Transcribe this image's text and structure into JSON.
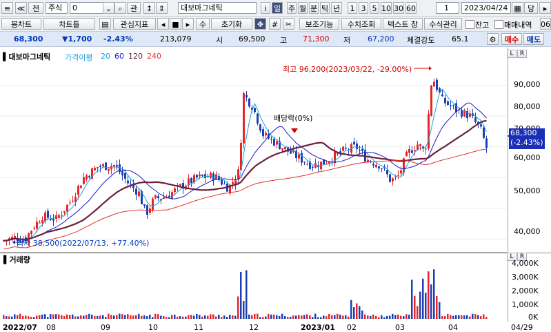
{
  "toolbar1": {
    "market": "주식",
    "code": "0",
    "search_icon": "search-icon",
    "gwan": "관",
    "stock_name": "대보마그네틱",
    "buttons": [
      "i",
      "일",
      "주",
      "월",
      "분",
      "틱",
      "년",
      "1",
      "3",
      "5",
      "10",
      "30",
      "60"
    ],
    "selected_period": "일",
    "count": "1",
    "date": "2023/04/24",
    "prev_label": "전",
    "dang": "당"
  },
  "toolbar2": {
    "bongchart": "봉차트",
    "charttool": "차트틀",
    "gwansim": "관심지표",
    "su": "수",
    "init": "초기화",
    "bojo": "보조기능",
    "suchi": "수치조회",
    "text_window": "텍스트 창",
    "formula": "수식관리",
    "jango": "잔고",
    "trade_history": "매매내역",
    "last": "06"
  },
  "info": {
    "price": "68,300",
    "change": "▼1,700",
    "rate": "-2.43%",
    "volume": "213,079",
    "open_label": "시",
    "open": "69,500",
    "high_label": "고",
    "high": "71,300",
    "low_label": "저",
    "low": "67,200",
    "strength_label": "체결강도",
    "strength": "65.1",
    "buy": "매수",
    "sell": "매도"
  },
  "price_pane": {
    "title": "대보마그네틱",
    "ma_label": "가격이평",
    "ma": [
      "20",
      "60",
      "120",
      "240"
    ],
    "ma_colors": [
      "#1ea0d8",
      "#1a1acd",
      "#6b1f3c",
      "#e03030"
    ],
    "high_annotation": "최고 96,200(2023/03/22, -29.00%)",
    "low_annotation": "최저 38,500(2022/07/13, +77.40%)",
    "dividend_label": "배당락(0%)",
    "current_price": "68,300",
    "current_rate": "(-2.43%)",
    "y_ticks": [
      "90,000",
      "80,000",
      "70,000",
      "60,000",
      "50,000",
      "40,000"
    ]
  },
  "volume_pane": {
    "title": "거래량",
    "y_ticks": [
      "4,000K",
      "3,000K",
      "2,000K",
      "1,000K",
      "0K"
    ]
  },
  "x_ticks": [
    "2022/07",
    "08",
    "09",
    "10",
    "11",
    "12",
    "2023/01",
    "02",
    "03",
    "04",
    "04/29"
  ],
  "colors": {
    "up": "#e4262a",
    "down": "#1c3fb5",
    "bg": "#ffffff"
  },
  "chart_data": {
    "type": "candlestick",
    "ylim": [
      36500,
      97500
    ],
    "highest": 96200,
    "lowest": 38500,
    "last_close": 68300
  }
}
